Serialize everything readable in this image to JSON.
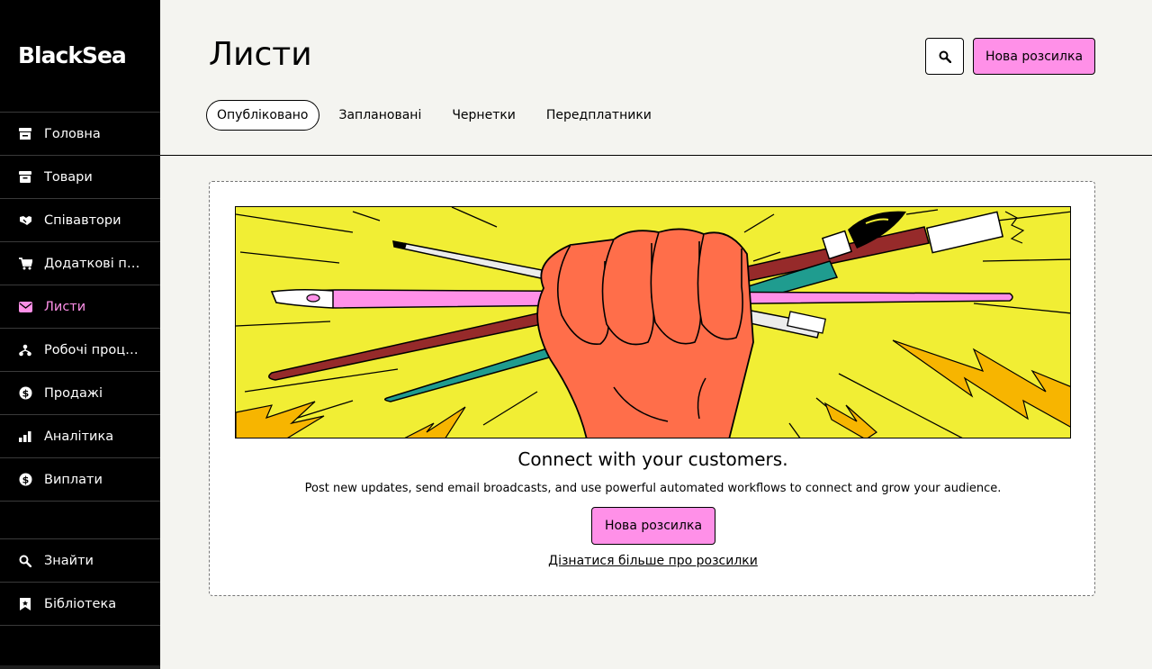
{
  "brand": {
    "logo": "BlackSea",
    "accent": "#ff90e8",
    "banner_bg": "#f1ee34"
  },
  "sidebar": {
    "items": [
      {
        "label": "Головна",
        "icon": "store-icon"
      },
      {
        "label": "Товари",
        "icon": "archive-icon"
      },
      {
        "label": "Співавтори",
        "icon": "handshake-icon"
      },
      {
        "label": "Додаткові пр...",
        "icon": "cart-icon"
      },
      {
        "label": "Листи",
        "icon": "envelope-icon",
        "active": true
      },
      {
        "label": "Робочі проце...",
        "icon": "workflow-icon"
      },
      {
        "label": "Продажі",
        "icon": "dollar-circle-icon"
      },
      {
        "label": "Аналітика",
        "icon": "bar-chart-icon"
      },
      {
        "label": "Виплати",
        "icon": "dollar-circle-icon"
      }
    ],
    "bottom": [
      {
        "label": "Знайти",
        "icon": "search-icon"
      },
      {
        "label": "Бібліотека",
        "icon": "bookmark-icon"
      }
    ]
  },
  "header": {
    "title": "Листи",
    "new_button": "Нова розсилка",
    "tabs": [
      "Опубліковано",
      "Заплановані",
      "Чернетки",
      "Передплатники"
    ],
    "active_tab": "Опубліковано"
  },
  "empty_state": {
    "title": "Connect with your customers.",
    "description": "Post new updates, send email broadcasts, and use powerful automated workflows to connect and grow your audience.",
    "button": "Нова розсилка",
    "link": "Дізнатися більше про розсилки"
  }
}
